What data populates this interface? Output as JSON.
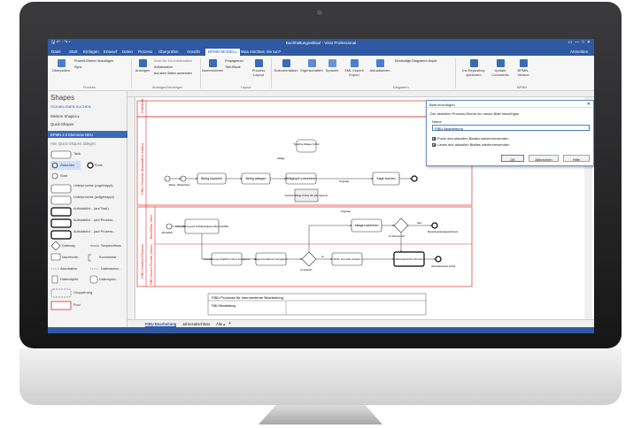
{
  "window": {
    "title": "Buchhaltungsablauf - Visio Professional",
    "qa": "🖫 ↶ · ↷ ▾"
  },
  "menu_tabs": [
    "Datei",
    "Start",
    "Einfügen",
    "Entwurf",
    "Daten",
    "Prozess",
    "Überprüfen",
    "Ansicht",
    "BPMN-MODELL",
    "Was möchten Sie tun?"
  ],
  "signin": "Anmelden",
  "ribbon": {
    "buttons": [
      {
        "label": "Überprüfen",
        "color": "#4a7fd0"
      },
      {
        "label": "Anzeigen",
        "color": "#3a6bb5"
      },
      {
        "label": "Nummerieren",
        "color": "#3a6bb5"
      },
      {
        "label": "Prozess Layout",
        "color": "#3a6bb5"
      },
      {
        "label": "Dokumentation",
        "color": "#3a6bb5"
      },
      {
        "label": "Eigenschaften",
        "color": "#5b8ad6"
      },
      {
        "label": "Sprache",
        "color": "#6b93d8"
      },
      {
        "label": "XML Import/ Export",
        "color": "#4a7fd0"
      },
      {
        "label": "Aktualisieren",
        "color": "#4a7fd0"
      },
      {
        "label": "Ins Repository speichern",
        "color": "#3a6bb5"
      },
      {
        "label": "Update Comments",
        "color": "#3a6bb5"
      },
      {
        "label": "BPMN-Version",
        "color": "#3a6bb5"
      }
    ],
    "small": [
      "Prozeß-Ebene hinzufügen",
      "Sync",
      "Ende der Kol-Kollaboration",
      "Kollaboration",
      "Auf allen Seiten anwenden",
      "Propagieren",
      "Titel-Block",
      "Eindeutige Diagramm-Kopie"
    ],
    "groups": [
      "Prozess",
      "Anzeigen/Verbergen",
      "Layout",
      "Diagramm",
      "BPMN"
    ]
  },
  "shapes": {
    "title": "Shapes",
    "tabs": "SCHABLONEN   SUCHEN",
    "more": "Weitere Shapes  ▸",
    "quick": "Quick-Shapes",
    "stencil": "BPMN 2.0 Elemente NEU",
    "hint": "Hier Quick-Shapes ablegen",
    "items": [
      "Task",
      "Zwischen",
      "Ende",
      "Start",
      "Unterprozess (zugeklappt)",
      "Unterprozess (aufgeklappt)",
      "Aufrufaktivi... (auf Task)",
      "Aufrufaktivi... (auf Prozess...",
      "Aufrufaktivi... (auf Prozess...",
      "Gateway",
      "Sequenzfluss",
      "Nachrichte...",
      "Kommentar",
      "Assoziation",
      "Datenassoz...",
      "Datenobjekt",
      "Datenspeic...",
      "Gruppierung",
      "Pool"
    ]
  },
  "diagram": {
    "lanes": [
      "Prüfstelle",
      "FIBU Prozess (Backoffice intern)",
      "FIBU Kontrol-Prozess",
      "BackOffice intern",
      "FIBU Service Provider (extern)"
    ],
    "tasks": [
      "Beleg kopieren",
      "Beleg ablegen",
      "Belegkopie vorkontieren",
      "Sage buchen",
      "Vorkontierung auf Vollständigkeit prüfen (AKDR)",
      "Ablage nachführen",
      "Vorkontierung inhaltlich prüfen/ korrigieren",
      "Sage kontrollieren/ korrigieren",
      "MVSt. Formular erstellen",
      "Jahresabschluss Prozess"
    ],
    "labels": [
      "Beleg",
      "Monatliche Erfassung erhalten",
      "Wiederholen",
      "Typische Ablage/ Archiv",
      "Ablage",
      "Originale",
      "Zwischenablage Ordner (für jede Agentur)",
      "Monatlich",
      "Jahresabschluss erfolgt",
      "Monat/Quartal abgeschlossen",
      "Ist Quartal?",
      "Ist Jahresende?",
      "Nein",
      "Ja",
      "Originals"
    ],
    "title_block": {
      "heading": "FIBU Prozesse für intern/externe Bearbeitung",
      "sub": "FIBU Bearbeitung"
    }
  },
  "dialog": {
    "title": "Blatt hinzufügen",
    "prompt": "Der aktuellen Prozess-Ebene ein neues Blatt hinzufügen",
    "name_label": "Name",
    "name_value": "FIBU Bearbeitung",
    "check1": "Pools des aktuellen Blattes wiederverwenden",
    "check2": "Lanes des aktuellen Blattes wiederverwenden",
    "ok": "OK",
    "cancel": "Abbrechen",
    "help": "Hilfe"
  },
  "page_tabs": [
    "FIBU Bearbeitung",
    "Jahresabschluss",
    "Alle ▴",
    "+"
  ]
}
